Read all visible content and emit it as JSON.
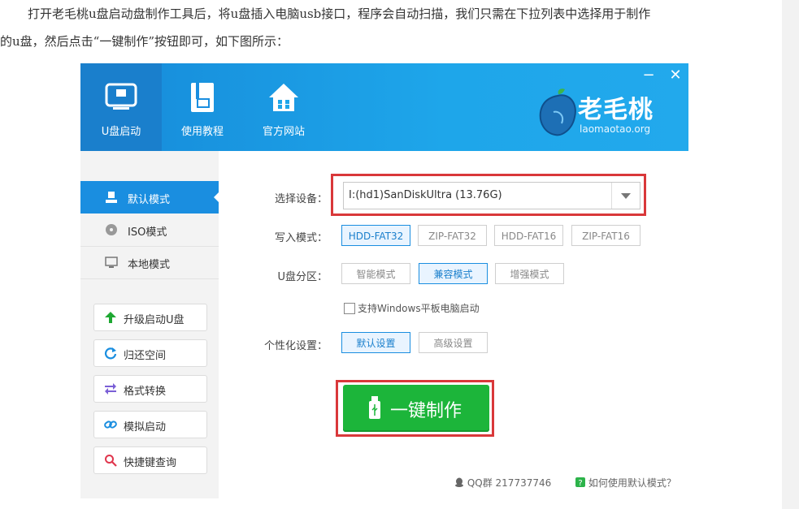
{
  "article": {
    "line1": "打开老毛桃u盘启动盘制作工具后，将u盘插入电脑usb接口，程序会自动扫描，我们只需在下拉列表中选择用于制作",
    "line2": "的u盘，然后点击“一键制作”按钮即可，如下图所示："
  },
  "app": {
    "nav": [
      {
        "label": "U盘启动",
        "icon": "usb-drive-icon"
      },
      {
        "label": "使用教程",
        "icon": "document-icon"
      },
      {
        "label": "官方网站",
        "icon": "home-icon"
      }
    ],
    "logo": {
      "text": "老毛桃",
      "site": "laomaotao.org"
    },
    "window": {
      "minimize": "−",
      "close": "✕"
    },
    "modes": [
      {
        "label": "默认模式",
        "icon": "usb-drive-icon"
      },
      {
        "label": "ISO模式",
        "icon": "disc-icon"
      },
      {
        "label": "本地模式",
        "icon": "monitor-icon"
      }
    ],
    "tools": [
      {
        "label": "升级启动U盘",
        "icon": "arrow-up-icon",
        "color": "#1ea832"
      },
      {
        "label": "归还空间",
        "icon": "refresh-icon",
        "color": "#1a8ee0"
      },
      {
        "label": "格式转换",
        "icon": "swap-icon",
        "color": "#7a5fd6"
      },
      {
        "label": "模拟启动",
        "icon": "link-icon",
        "color": "#1a8ee0"
      },
      {
        "label": "快捷键查询",
        "icon": "search-icon",
        "color": "#e0364d"
      }
    ],
    "form": {
      "device_label": "选择设备：",
      "device_value": "I:(hd1)SanDiskUltra (13.76G)",
      "write_label": "写入模式：",
      "write_modes": [
        "HDD-FAT32",
        "ZIP-FAT32",
        "HDD-FAT16",
        "ZIP-FAT16"
      ],
      "partition_label": "U盘分区：",
      "partitions": [
        "智能模式",
        "兼容模式",
        "增强模式"
      ],
      "tablet_checkbox": "支持Windows平板电脑启动",
      "personal_label": "个性化设置：",
      "personal_options": [
        "默认设置",
        "高级设置"
      ],
      "make_button": "一键制作"
    },
    "footer": {
      "qq": "QQ群 217737746",
      "help": "如何使用默认模式？"
    },
    "colors": {
      "header": "#1ea6ea",
      "accent": "#1a8ee0",
      "primary_button": "#1cb53a",
      "highlight_box": "#d9383a"
    }
  }
}
